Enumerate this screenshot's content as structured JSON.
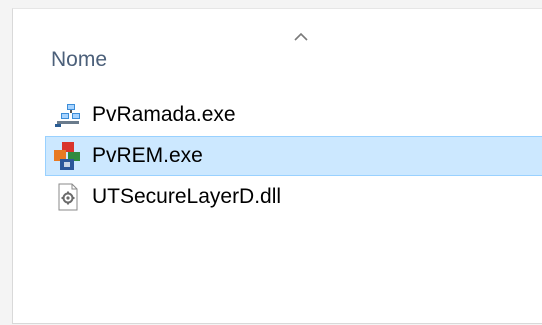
{
  "header": {
    "column_name": "Nome",
    "sort_icon": "chevron-up-icon"
  },
  "files": [
    {
      "name": "PvRamada.exe",
      "icon": "network-app-icon",
      "selected": false
    },
    {
      "name": "PvREM.exe",
      "icon": "office-app-icon",
      "selected": true
    },
    {
      "name": "UTSecureLayerD.dll",
      "icon": "dll-file-icon",
      "selected": false
    }
  ],
  "colors": {
    "selection_fill": "#cce8ff",
    "selection_border": "#99d1ff",
    "header_text": "#4c607a"
  }
}
